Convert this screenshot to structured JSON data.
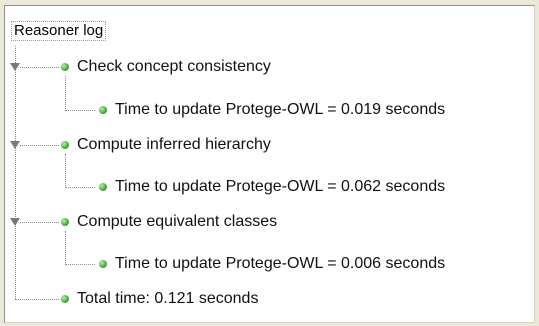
{
  "tree": {
    "root": {
      "label": "Reasoner log"
    },
    "nodes": [
      {
        "label": "Check concept consistency",
        "child": {
          "label": "Time to update Protege-OWL = 0.019 seconds"
        }
      },
      {
        "label": "Compute inferred hierarchy",
        "child": {
          "label": "Time to update Protege-OWL = 0.062 seconds"
        }
      },
      {
        "label": "Compute equivalent classes",
        "child": {
          "label": "Time to update Protege-OWL = 0.006 seconds"
        }
      }
    ],
    "total": {
      "label": "Total time: 0.121 seconds"
    }
  },
  "colors": {
    "node_dot": "#4caf3f",
    "tree_lines": "#8a8a8a",
    "background": "#ffffff"
  },
  "icons": {
    "expander": "expanded-triangle-icon",
    "node": "green-dot-icon"
  }
}
